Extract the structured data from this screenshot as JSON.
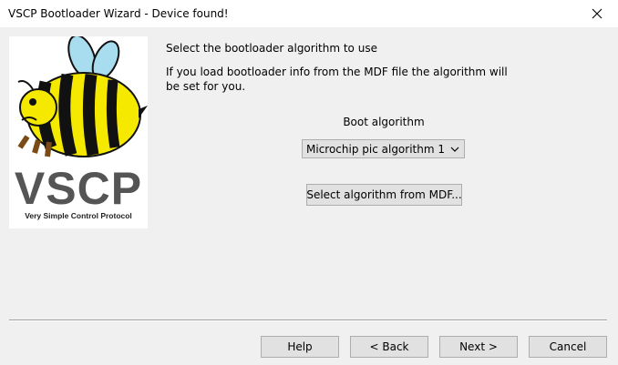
{
  "window": {
    "title": "VSCP  Bootloader Wizard - Device found!"
  },
  "logo": {
    "title": "VSCP",
    "subtitle": "Very Simple Control Protocol"
  },
  "content": {
    "heading": "Select the bootloader algorithm to use",
    "info_line1": "If you load bootloader info from the MDF file the algorithm will",
    "info_line2": "be set for you.",
    "boot_label": "Boot algorithm",
    "algorithm_selected": "Microchip pic algorithm 1",
    "select_from_mdf_label": "Select algorithm from MDF..."
  },
  "footer": {
    "help_label": "Help",
    "back_label": "< Back",
    "next_label": "Next >",
    "cancel_label": "Cancel"
  },
  "icons": {
    "close": "close-icon",
    "dropdown": "chevron-down-icon"
  }
}
